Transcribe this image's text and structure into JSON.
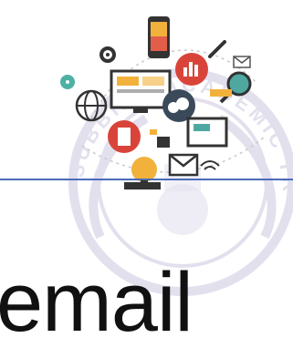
{
  "slide": {
    "heading": "email",
    "watermark_text": "SUBBIAH ACADEMIC TRUST",
    "rule_color": "#4a6cb8"
  },
  "icons": [
    "phone-icon",
    "gear-icon",
    "bar-chart-icon",
    "pen-icon",
    "mail-icon",
    "magnifier-icon",
    "chat-bubble-icon",
    "monitor-icon",
    "globe-icon",
    "cloud-icon",
    "document-icon",
    "folder-icon",
    "lightbulb-icon",
    "envelope-icon",
    "wifi-icon",
    "keyboard-icon"
  ]
}
